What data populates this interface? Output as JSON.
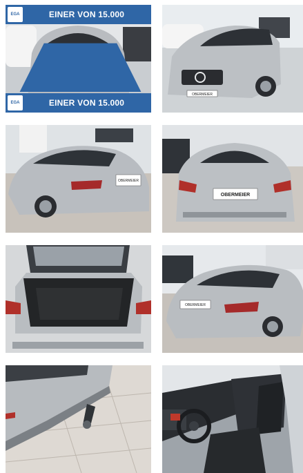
{
  "gallery": {
    "banner": {
      "label": "EINER VON 15.000",
      "logo_text": "EGA"
    },
    "photos": [
      {
        "name": "front"
      },
      {
        "name": "front-angle",
        "plate": "OBERMEIER"
      },
      {
        "name": "rear-left",
        "plate": "OBERMEIER"
      },
      {
        "name": "rear",
        "plate": "OBERMEIER"
      },
      {
        "name": "trunk-open"
      },
      {
        "name": "rear-left-outdoor",
        "plate": "OBERMEIER"
      },
      {
        "name": "tow-hitch"
      },
      {
        "name": "interior"
      }
    ]
  }
}
